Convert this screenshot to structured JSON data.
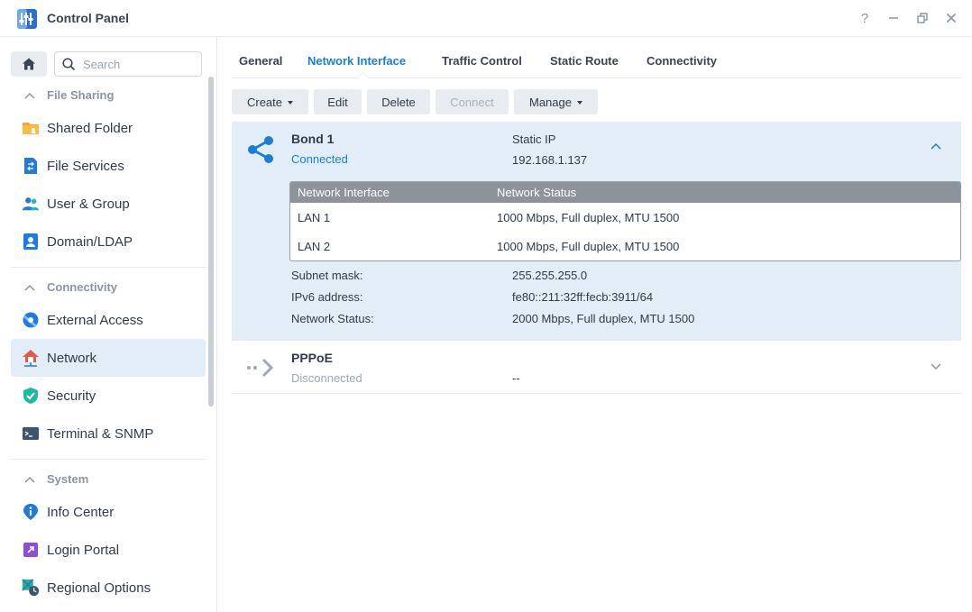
{
  "window": {
    "title": "Control Panel",
    "controls": {
      "help": "?",
      "minimize": "—",
      "restore": "❐",
      "close": "✕"
    }
  },
  "sidebar": {
    "search_placeholder": "Search",
    "sections": [
      {
        "title": "File Sharing",
        "items": [
          {
            "label": "Shared Folder",
            "icon": "shared-folder-icon"
          },
          {
            "label": "File Services",
            "icon": "file-services-icon"
          },
          {
            "label": "User & Group",
            "icon": "user-group-icon"
          },
          {
            "label": "Domain/LDAP",
            "icon": "domain-ldap-icon"
          }
        ]
      },
      {
        "title": "Connectivity",
        "items": [
          {
            "label": "External Access",
            "icon": "external-access-icon"
          },
          {
            "label": "Network",
            "icon": "network-icon",
            "active": true
          },
          {
            "label": "Security",
            "icon": "security-shield-icon"
          },
          {
            "label": "Terminal & SNMP",
            "icon": "terminal-icon"
          }
        ]
      },
      {
        "title": "System",
        "items": [
          {
            "label": "Info Center",
            "icon": "info-center-icon"
          },
          {
            "label": "Login Portal",
            "icon": "login-portal-icon"
          },
          {
            "label": "Regional Options",
            "icon": "regional-options-icon"
          }
        ]
      }
    ]
  },
  "tabs": [
    {
      "label": "General"
    },
    {
      "label": "Network Interface",
      "active": true
    },
    {
      "label": "Traffic Control"
    },
    {
      "label": "Static Route"
    },
    {
      "label": "Connectivity"
    }
  ],
  "toolbar": {
    "create": "Create",
    "edit": "Edit",
    "delete": "Delete",
    "connect": "Connect",
    "manage": "Manage"
  },
  "interfaces": {
    "bond": {
      "name": "Bond 1",
      "status": "Connected",
      "type": "Static IP",
      "ip": "192.168.1.137",
      "table": {
        "headers": [
          "Network Interface",
          "Network Status"
        ],
        "rows": [
          [
            "LAN 1",
            "1000 Mbps, Full duplex, MTU 1500"
          ],
          [
            "LAN 2",
            "1000 Mbps, Full duplex, MTU 1500"
          ]
        ]
      },
      "details": [
        {
          "label": "Subnet mask:",
          "value": "255.255.255.0"
        },
        {
          "label": "IPv6 address:",
          "value": "fe80::211:32ff:fecb:3911/64"
        },
        {
          "label": "Network Status:",
          "value": "2000 Mbps, Full duplex, MTU 1500"
        }
      ]
    },
    "pppoe": {
      "name": "PPPoE",
      "status": "Disconnected",
      "ip": "--"
    }
  },
  "colors": {
    "accent": "#1a7fd4",
    "connected": "#1a7fd4",
    "disconnected": "#a0a8b2",
    "selected_bg": "#e3edf8"
  }
}
